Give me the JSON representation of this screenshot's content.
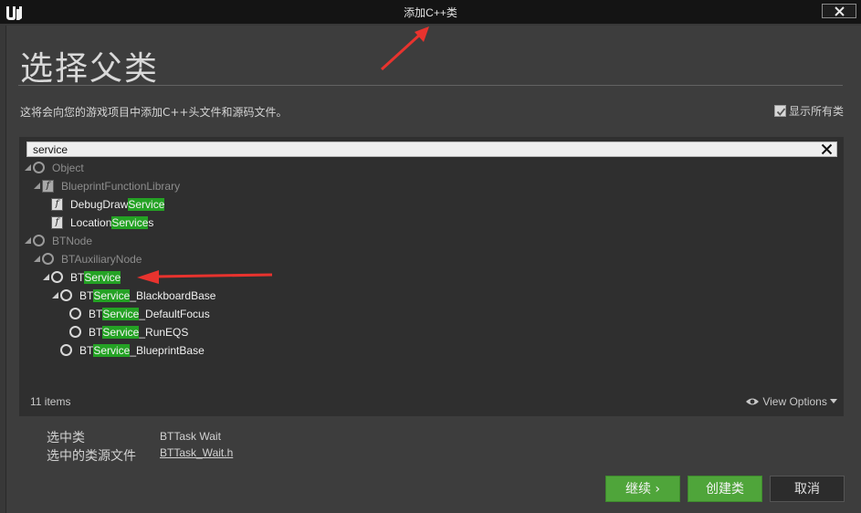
{
  "window": {
    "title": "添加C++类",
    "close_icon": "close-icon"
  },
  "header": {
    "heading": "选择父类",
    "description": "这将会向您的游戏项目中添加C++头文件和源码文件。",
    "show_all_label": "显示所有类",
    "show_all_checked": true
  },
  "search": {
    "value": "service"
  },
  "tree": {
    "rows": [
      {
        "indent": 0,
        "icon": "class-circle",
        "pre": "Object",
        "match": "",
        "post": "",
        "dim": true,
        "expanded": true
      },
      {
        "indent": 1,
        "icon": "blueprint-function-library-icon",
        "pre": "BlueprintFunctionLibrary",
        "match": "",
        "post": "",
        "dim": true,
        "expanded": true
      },
      {
        "indent": 2,
        "icon": "blueprint-function-library-icon",
        "pre": "DebugDraw",
        "match": "Service",
        "post": "",
        "dim": false,
        "expanded": false
      },
      {
        "indent": 2,
        "icon": "blueprint-function-library-icon",
        "pre": "Location",
        "match": "Service",
        "post": "s",
        "dim": false,
        "expanded": false
      },
      {
        "indent": 0,
        "icon": "class-circle",
        "pre": "BTNode",
        "match": "",
        "post": "",
        "dim": true,
        "expanded": true
      },
      {
        "indent": 1,
        "icon": "class-circle",
        "pre": "BTAuxiliaryNode",
        "match": "",
        "post": "",
        "dim": true,
        "expanded": true
      },
      {
        "indent": 2,
        "icon": "class-circle",
        "pre": "BT",
        "match": "Service",
        "post": "",
        "dim": false,
        "expanded": true
      },
      {
        "indent": 3,
        "icon": "class-circle",
        "pre": "BT",
        "match": "Service",
        "post": "_BlackboardBase",
        "dim": false,
        "expanded": true
      },
      {
        "indent": 4,
        "icon": "class-circle",
        "pre": "BT",
        "match": "Service",
        "post": "_DefaultFocus",
        "dim": false,
        "expanded": false
      },
      {
        "indent": 4,
        "icon": "class-circle",
        "pre": "BT",
        "match": "Service",
        "post": "_RunEQS",
        "dim": false,
        "expanded": false
      },
      {
        "indent": 3,
        "icon": "class-circle",
        "pre": "BT",
        "match": "Service",
        "post": "_BlueprintBase",
        "dim": false,
        "expanded": false
      }
    ],
    "item_count": "11 items",
    "view_options": "View Options"
  },
  "selection": {
    "class_label": "选中类",
    "class_value": "BTTask Wait",
    "source_label": "选中的类源文件",
    "source_value": "BTTask_Wait.h"
  },
  "buttons": {
    "continue": "继续 ›",
    "create": "创建类",
    "cancel": "取消"
  },
  "colors": {
    "highlight": "#24a224",
    "annotation_arrow": "#e8332e",
    "primary_button": "#4fa53a"
  }
}
